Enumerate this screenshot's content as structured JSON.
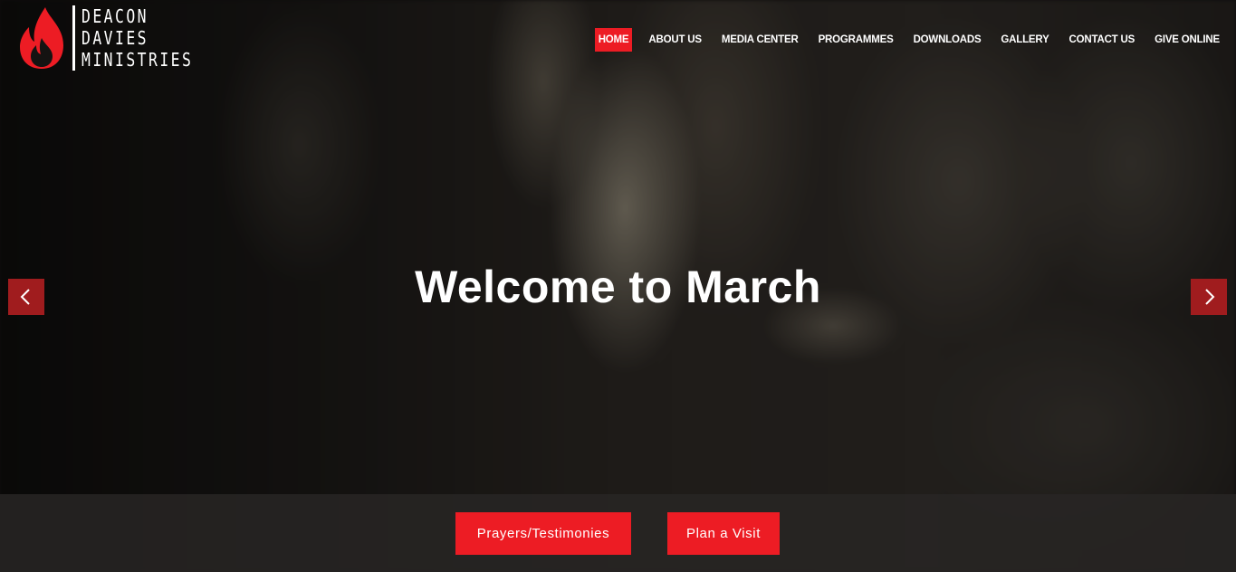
{
  "brand": {
    "line1": "DEACON",
    "line2": "DAVIES",
    "line3": "MINISTRIES",
    "logo_icon": "flame-icon",
    "accent_color": "#ed1c24"
  },
  "nav": {
    "items": [
      {
        "label": "HOME",
        "active": true
      },
      {
        "label": "ABOUT US",
        "active": false
      },
      {
        "label": "MEDIA CENTER",
        "active": false
      },
      {
        "label": "PROGRAMMES",
        "active": false
      },
      {
        "label": "DOWNLOADS",
        "active": false
      },
      {
        "label": "GALLERY",
        "active": false
      },
      {
        "label": "CONTACT US",
        "active": false
      },
      {
        "label": "GIVE ONLINE",
        "active": false
      }
    ]
  },
  "hero": {
    "headline": "Welcome to March",
    "prev_icon": "chevron-left-icon",
    "next_icon": "chevron-right-icon",
    "arrow_color": "#a01c1e"
  },
  "actions": {
    "prayers_label": "Prayers/Testimonies",
    "visit_label": "Plan a Visit"
  }
}
